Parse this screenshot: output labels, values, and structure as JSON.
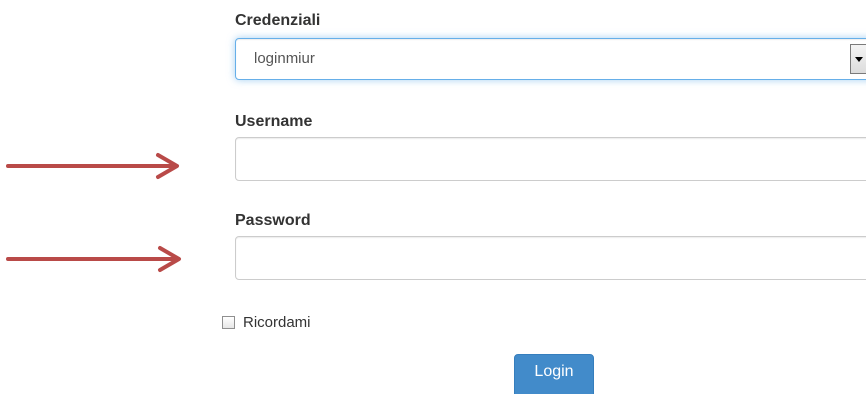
{
  "form": {
    "credentials": {
      "label": "Credenziali",
      "selected_value": "loginmiur",
      "arrow_icon": "chevron-down-icon"
    },
    "username": {
      "label": "Username",
      "value": "",
      "placeholder": ""
    },
    "password": {
      "label": "Password",
      "value": "",
      "placeholder": ""
    },
    "remember": {
      "label": "Ricordami",
      "checked": false
    },
    "login_button_label": "Login"
  },
  "annotations": {
    "arrow_color": "#b94a48",
    "arrow_icon": "arrow-right-icon"
  },
  "colors": {
    "primary_button": "#428bca",
    "focus_border": "#66afe9",
    "text": "#333333"
  }
}
